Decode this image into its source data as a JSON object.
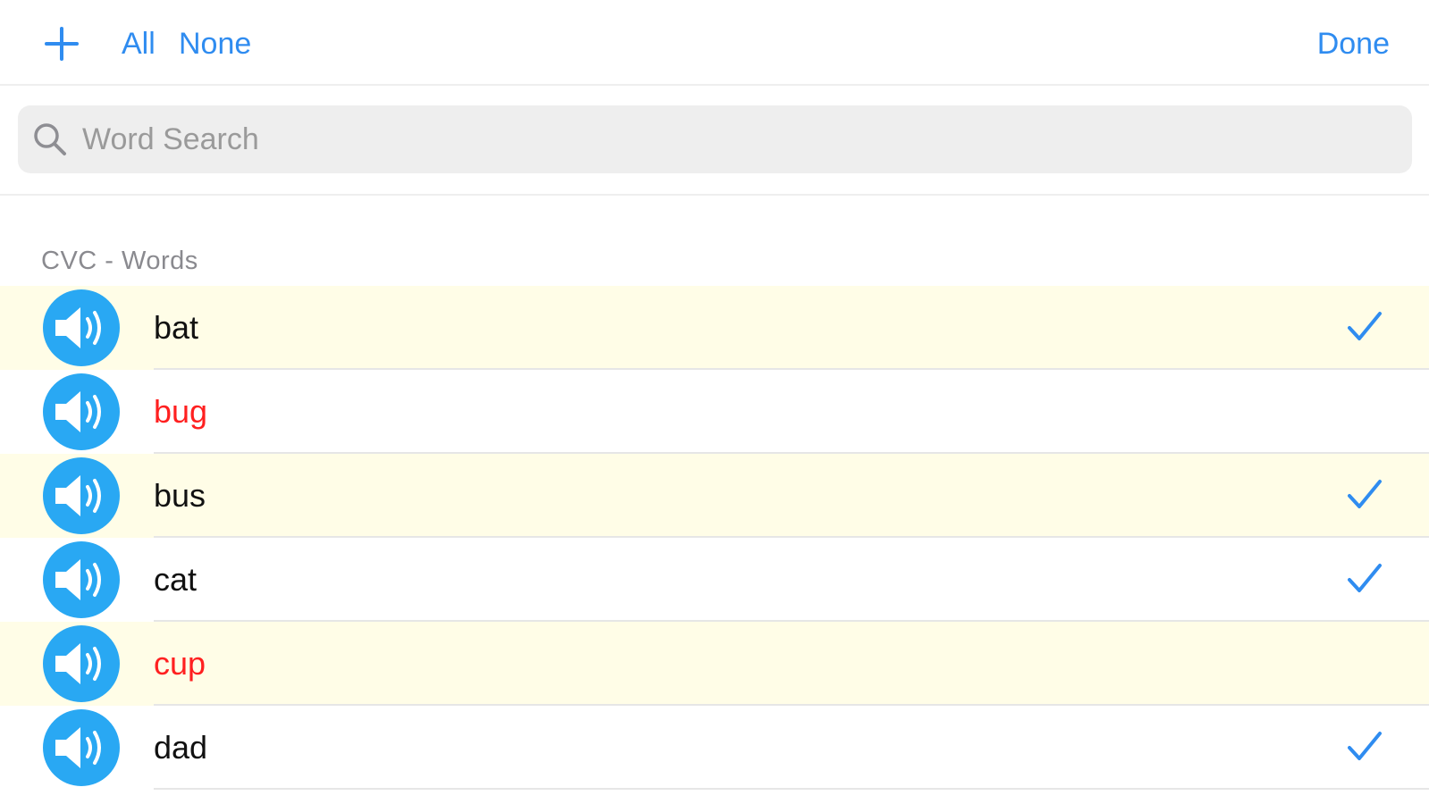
{
  "toolbar": {
    "add_icon": "plus-icon",
    "all_label": "All",
    "none_label": "None",
    "done_label": "Done",
    "accent_color": "#2f8cf0"
  },
  "search": {
    "placeholder": "Word Search",
    "value": "",
    "icon": "search-icon"
  },
  "section": {
    "title": "CVC - Words"
  },
  "words": [
    {
      "label": "bat",
      "checked": true,
      "color": "#111111",
      "shaded": true
    },
    {
      "label": "bug",
      "checked": false,
      "color": "#ff2020",
      "shaded": false
    },
    {
      "label": "bus",
      "checked": true,
      "color": "#111111",
      "shaded": true
    },
    {
      "label": "cat",
      "checked": true,
      "color": "#111111",
      "shaded": false
    },
    {
      "label": "cup",
      "checked": false,
      "color": "#ff2020",
      "shaded": true
    },
    {
      "label": "dad",
      "checked": true,
      "color": "#111111",
      "shaded": false
    }
  ],
  "colors": {
    "speaker_bg": "#29a8f3",
    "checkmark": "#2f8cf0",
    "shaded_row": "#fffde7",
    "unrecorded_word": "#ff2020"
  }
}
